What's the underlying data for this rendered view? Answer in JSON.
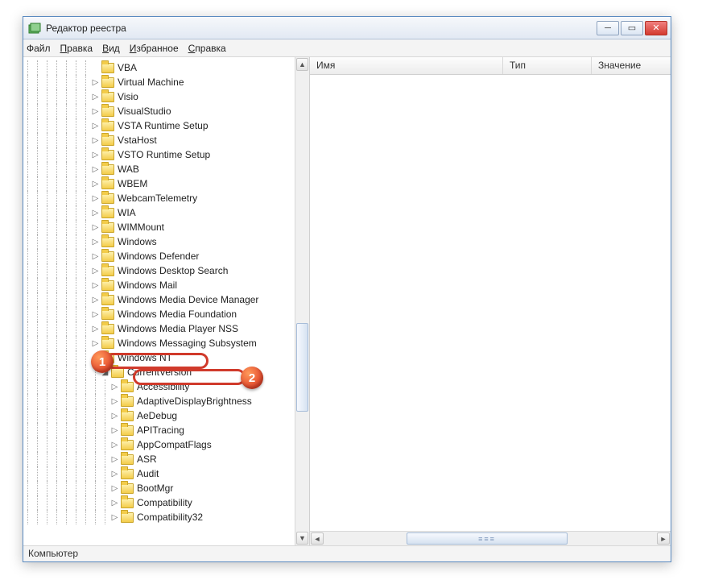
{
  "window": {
    "title": "Редактор реестра"
  },
  "menu": {
    "file": {
      "pre": "Ф",
      "u": "",
      "post": "айл"
    },
    "edit": {
      "pre": "",
      "u": "П",
      "post": "равка"
    },
    "view": {
      "pre": "",
      "u": "В",
      "post": "ид"
    },
    "fav": {
      "pre": "",
      "u": "И",
      "post": "збранное"
    },
    "help": {
      "pre": "",
      "u": "С",
      "post": "правка"
    }
  },
  "columns": {
    "name": "Имя",
    "type": "Тип",
    "value": "Значение"
  },
  "status": "Компьютер",
  "levels": {
    "base": 7,
    "nt": 7,
    "cv": 8,
    "cvchild": 9
  },
  "tree": {
    "top": [
      "VBA",
      "Virtual Machine",
      "Visio",
      "VisualStudio",
      "VSTA Runtime Setup",
      "VstaHost",
      "VSTO Runtime Setup",
      "WAB",
      "WBEM",
      "WebcamTelemetry",
      "WIA",
      "WIMMount",
      "Windows",
      "Windows Defender",
      "Windows Desktop Search",
      "Windows Mail",
      "Windows Media Device Manager",
      "Windows Media Foundation",
      "Windows Media Player NSS",
      "Windows Messaging Subsystem"
    ],
    "nt": "Windows NT",
    "cv": "CurrentVersion",
    "cvchildren": [
      "Accessibility",
      "AdaptiveDisplayBrightness",
      "AeDebug",
      "APITracing",
      "AppCompatFlags",
      "ASR",
      "Audit",
      "BootMgr",
      "Compatibility",
      "Compatibility32"
    ]
  },
  "annotations": {
    "a1": "1",
    "a2": "2"
  }
}
